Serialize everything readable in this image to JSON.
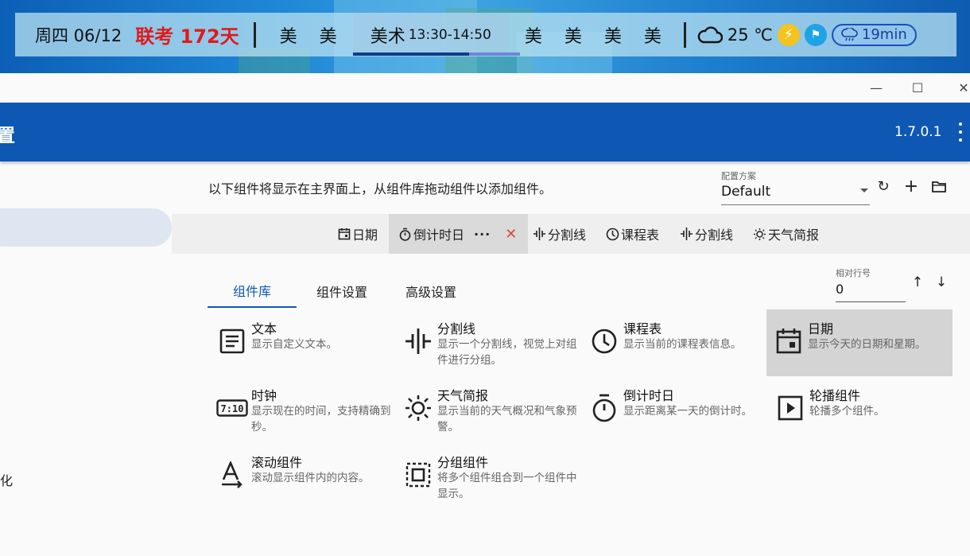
{
  "topbar": {
    "date": "周四 06/12",
    "countdown": "联考 172天",
    "classes_before": [
      "美",
      "美"
    ],
    "current_class": "美术",
    "current_time": "13:30-14:50",
    "classes_after": [
      "美",
      "美",
      "美",
      "美"
    ],
    "temperature": "25 ℃",
    "rain": "19min",
    "icons": [
      "cloud-icon",
      "bolt-icon",
      "flag-icon",
      "rain-cloud-icon"
    ]
  },
  "window": {
    "title_fragment": "置",
    "version": "1.7.0.1",
    "minimize": "—",
    "maximize": "☐",
    "close": "✕"
  },
  "sidebar": {
    "fragment": "化"
  },
  "main": {
    "intro": "以下组件将显示在主界面上，从组件库拖动组件以添加组件。",
    "scheme_label": "配置方案",
    "scheme_value": "Default",
    "toolbar": {
      "refresh": "↻",
      "add": "+",
      "folder": "folder-icon"
    },
    "placed_components": [
      {
        "label": "日期",
        "icon": "calendar-icon"
      },
      {
        "label": "倒计时日",
        "icon": "stopwatch-icon",
        "selected": true
      },
      {
        "label": "分割线",
        "icon": "separator-icon"
      },
      {
        "label": "课程表",
        "icon": "clock-icon"
      },
      {
        "label": "分割线",
        "icon": "separator-icon"
      },
      {
        "label": "天气简报",
        "icon": "sun-icon"
      }
    ],
    "selected_more": "···",
    "selected_remove": "✕",
    "tabs": [
      "组件库",
      "组件设置",
      "高级设置"
    ],
    "active_tab": "组件库",
    "row_label": "相对行号",
    "row_value": "0",
    "up": "↑",
    "down": "↓",
    "library": [
      {
        "title": "文本",
        "desc": "显示自定义文本。",
        "icon": "text-icon"
      },
      {
        "title": "分割线",
        "desc": "显示一个分割线，视觉上对组件进行分组。",
        "icon": "separator-icon"
      },
      {
        "title": "课程表",
        "desc": "显示当前的课程表信息。",
        "icon": "clock-icon"
      },
      {
        "title": "日期",
        "desc": "显示今天的日期和星期。",
        "icon": "calendar-icon",
        "highlighted": true
      },
      {
        "title": "时钟",
        "desc": "显示现在的时间，支持精确到秒。",
        "icon": "digital-clock-icon"
      },
      {
        "title": "天气简报",
        "desc": "显示当前的天气概况和气象预警。",
        "icon": "sun-icon"
      },
      {
        "title": "倒计时日",
        "desc": "显示距离某一天的倒计时。",
        "icon": "stopwatch-icon"
      },
      {
        "title": "轮播组件",
        "desc": "轮播多个组件。",
        "icon": "play-box-icon"
      },
      {
        "title": "滚动组件",
        "desc": "滚动显示组件内的内容。",
        "icon": "text-arrow-icon"
      },
      {
        "title": "分组组件",
        "desc": "将多个组件组合到一个组件中显示。",
        "icon": "group-icon"
      }
    ]
  },
  "colors": {
    "accent": "#0e58b3",
    "countdown": "#e01a1a",
    "remove": "#d24b3b"
  }
}
